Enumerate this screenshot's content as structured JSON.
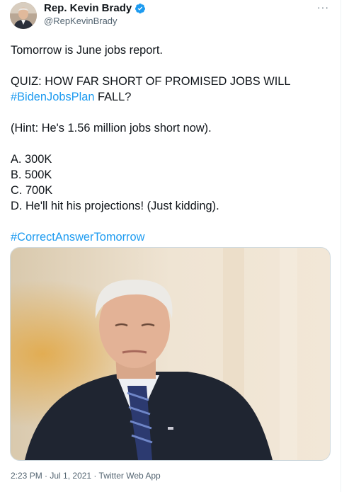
{
  "author": {
    "display_name": "Rep. Kevin Brady",
    "handle": "@RepKevinBrady",
    "verified": true
  },
  "more_glyph": "···",
  "tweet": {
    "line1": "Tomorrow is June jobs report.",
    "quiz_prefix": "QUIZ: HOW FAR SHORT OF PROMISED JOBS WILL",
    "hashtag1": "#BidenJobsPlan",
    "quiz_suffix": " FALL?",
    "hint": "(Hint: He's 1.56 million jobs short now).",
    "options": [
      "A. 300K",
      "B. 500K",
      "C. 700K",
      "D. He'll hit his projections! (Just kidding)."
    ],
    "hashtag2": "#CorrectAnswerTomorrow"
  },
  "meta": {
    "time": "2:23 PM",
    "date": "Jul 1, 2021",
    "source": "Twitter Web App",
    "separator": " · "
  },
  "colors": {
    "link": "#1d9bf0",
    "verified": "#1d9bf0",
    "text": "#0f1419",
    "secondary": "#536471"
  }
}
